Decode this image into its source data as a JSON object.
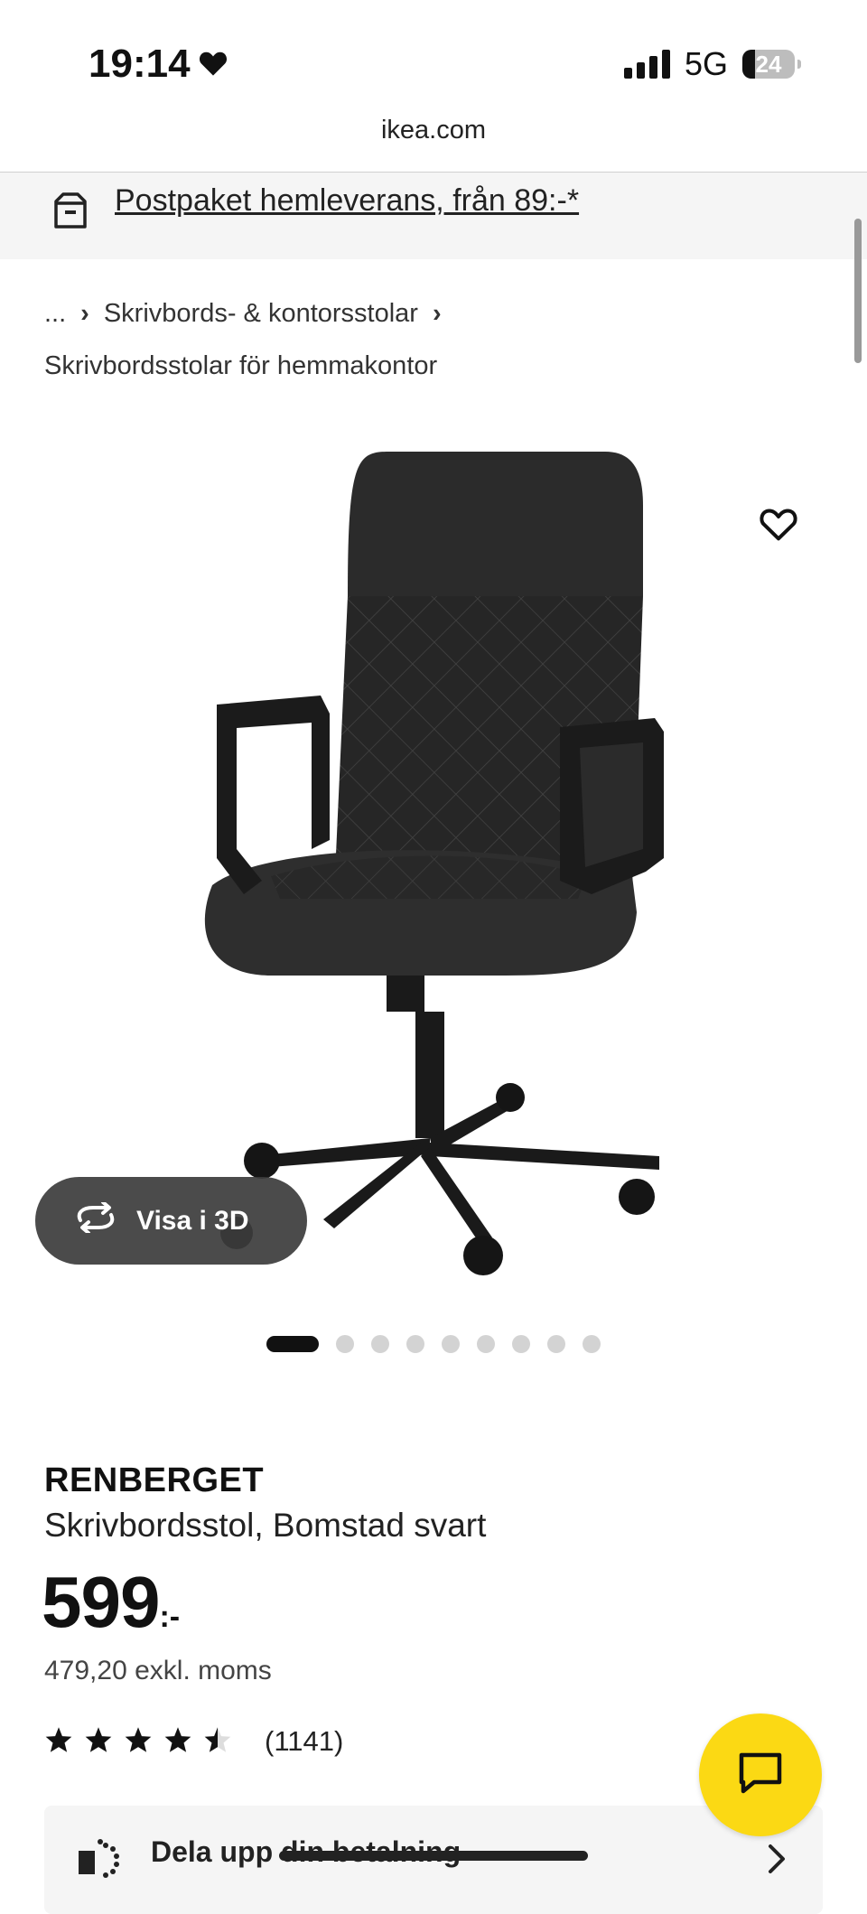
{
  "status": {
    "time": "19:14",
    "network": "5G",
    "battery": "24"
  },
  "url": "ikea.com",
  "promo": {
    "text": "Postpaket hemleverans, från 89:-*"
  },
  "breadcrumb": {
    "ellipsis": "...",
    "level1": "Skrivbords- & kontorsstolar",
    "level2": "Skrivbordsstolar för hemmakontor"
  },
  "view3d": {
    "label": "Visa i 3D"
  },
  "carousel": {
    "count": 9,
    "active_index": 0
  },
  "product": {
    "name": "RENBERGET",
    "description": "Skrivbordsstol, Bomstad svart",
    "price_main": "599",
    "price_suffix": ":-",
    "price_ex_vat": "479,20 exkl. moms",
    "rating_stars": 4.5,
    "review_count": "(1141)"
  },
  "payment": {
    "label": "Dela upp din betalning"
  },
  "colors": {
    "accent_yellow": "#fbd914",
    "promo_bg": "#f5f5f5"
  },
  "icons": [
    "heart-icon",
    "heart-outline-icon",
    "signal-icon",
    "battery-icon",
    "box-icon",
    "rotate-3d-icon",
    "star-icon",
    "chat-icon",
    "split-payment-icon",
    "chevron-right-icon"
  ]
}
